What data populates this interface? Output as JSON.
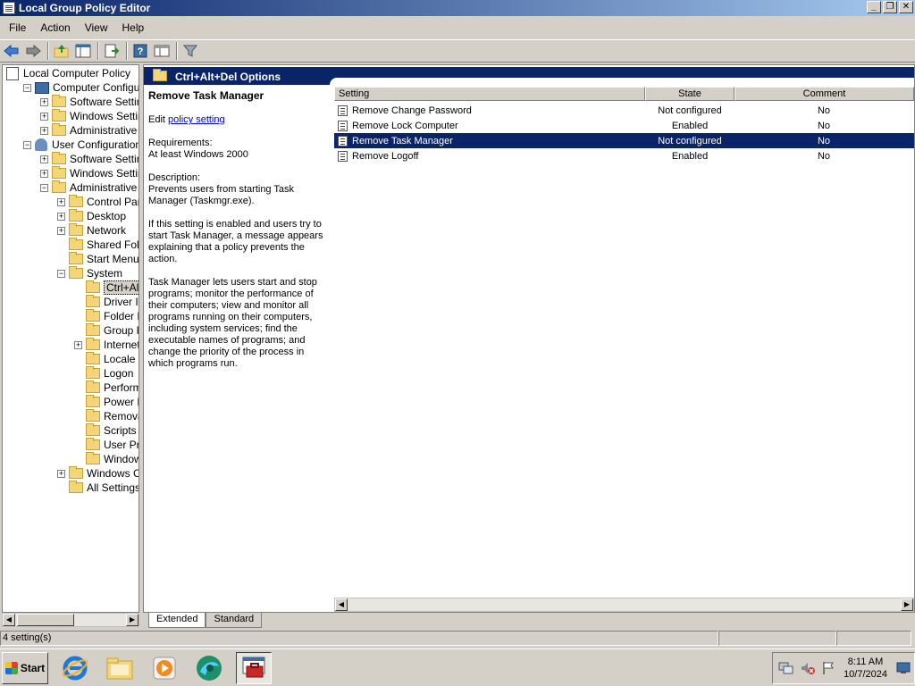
{
  "window": {
    "title": "Local Group Policy Editor"
  },
  "menu": [
    "File",
    "Action",
    "View",
    "Help"
  ],
  "tree": {
    "items": [
      {
        "label": "Local Computer Policy",
        "icon": "policy-icon",
        "indent": 0,
        "expander": "none"
      },
      {
        "label": "Computer Configuratio",
        "icon": "computer-icon",
        "indent": 1,
        "expander": "minus"
      },
      {
        "label": "Software Settings",
        "icon": "folder-icon",
        "indent": 2,
        "expander": "plus"
      },
      {
        "label": "Windows Settings",
        "icon": "folder-icon",
        "indent": 2,
        "expander": "plus"
      },
      {
        "label": "Administrative Tem",
        "icon": "folder-icon",
        "indent": 2,
        "expander": "plus"
      },
      {
        "label": "User Configuration",
        "icon": "user-icon",
        "indent": 1,
        "expander": "minus"
      },
      {
        "label": "Software Settings",
        "icon": "folder-icon",
        "indent": 2,
        "expander": "plus"
      },
      {
        "label": "Windows Settings",
        "icon": "folder-icon",
        "indent": 2,
        "expander": "plus"
      },
      {
        "label": "Administrative Tem",
        "icon": "folder-icon",
        "indent": 2,
        "expander": "minus"
      },
      {
        "label": "Control Panel",
        "icon": "folder-icon",
        "indent": 3,
        "expander": "plus"
      },
      {
        "label": "Desktop",
        "icon": "folder-icon",
        "indent": 3,
        "expander": "plus"
      },
      {
        "label": "Network",
        "icon": "folder-icon",
        "indent": 3,
        "expander": "plus"
      },
      {
        "label": "Shared Folders",
        "icon": "folder-icon",
        "indent": 3,
        "expander": "none"
      },
      {
        "label": "Start Menu and",
        "icon": "folder-icon",
        "indent": 3,
        "expander": "none"
      },
      {
        "label": "System",
        "icon": "folder-icon",
        "indent": 3,
        "expander": "minus"
      },
      {
        "label": "Ctrl+Alt+D",
        "icon": "folder-icon",
        "indent": 4,
        "expander": "none",
        "selected": true
      },
      {
        "label": "Driver Insta",
        "icon": "folder-icon",
        "indent": 4,
        "expander": "none"
      },
      {
        "label": "Folder Red",
        "icon": "folder-icon",
        "indent": 4,
        "expander": "none"
      },
      {
        "label": "Group Polic",
        "icon": "folder-icon",
        "indent": 4,
        "expander": "none"
      },
      {
        "label": "Internet Co",
        "icon": "folder-icon",
        "indent": 4,
        "expander": "plus"
      },
      {
        "label": "Locale Serv",
        "icon": "folder-icon",
        "indent": 4,
        "expander": "none"
      },
      {
        "label": "Logon",
        "icon": "folder-icon",
        "indent": 4,
        "expander": "none"
      },
      {
        "label": "Performanc",
        "icon": "folder-icon",
        "indent": 4,
        "expander": "none"
      },
      {
        "label": "Power Man",
        "icon": "folder-icon",
        "indent": 4,
        "expander": "none"
      },
      {
        "label": "Removable",
        "icon": "folder-icon",
        "indent": 4,
        "expander": "none"
      },
      {
        "label": "Scripts",
        "icon": "folder-icon",
        "indent": 4,
        "expander": "none"
      },
      {
        "label": "User Profile",
        "icon": "folder-icon",
        "indent": 4,
        "expander": "none"
      },
      {
        "label": "Windows H",
        "icon": "folder-icon",
        "indent": 4,
        "expander": "none"
      },
      {
        "label": "Windows Comp",
        "icon": "folder-icon",
        "indent": 3,
        "expander": "plus"
      },
      {
        "label": "All Settings",
        "icon": "all-settings-icon",
        "indent": 3,
        "expander": "none"
      }
    ]
  },
  "pane": {
    "header_title": "Ctrl+Alt+Del Options"
  },
  "description": {
    "title": "Remove Task Manager",
    "edit_prefix": "Edit ",
    "edit_link": "policy setting ",
    "requirements_label": "Requirements:",
    "requirements_value": "At least Windows 2000",
    "description_label": "Description:",
    "description_p1": "Prevents users from starting Task Manager (Taskmgr.exe).",
    "description_p2": "If this setting is enabled and users try to start Task Manager, a message appears explaining that a policy prevents the action.",
    "description_p3": "Task Manager lets users start and stop programs; monitor the performance of their computers; view and monitor all programs running on their computers, including system services; find the executable names of programs; and change the priority of the process in which programs run."
  },
  "list": {
    "columns": {
      "setting": "Setting",
      "state": "State",
      "comment": "Comment"
    },
    "rows": [
      {
        "setting": "Remove Change Password",
        "state": "Not configured",
        "comment": "No"
      },
      {
        "setting": "Remove Lock Computer",
        "state": "Enabled",
        "comment": "No"
      },
      {
        "setting": "Remove Task Manager",
        "state": "Not configured",
        "comment": "No",
        "selected": true
      },
      {
        "setting": "Remove Logoff",
        "state": "Enabled",
        "comment": "No"
      }
    ]
  },
  "tabs": [
    "Extended",
    "Standard"
  ],
  "status": {
    "count": "4 setting(s)"
  },
  "taskbar": {
    "start_label": "Start",
    "time": "8:11 AM",
    "date": "10/7/2024"
  },
  "colors": {
    "selection": "#0a246a",
    "title_gradient_start": "#0a246a",
    "title_gradient_end": "#a6caf0"
  }
}
